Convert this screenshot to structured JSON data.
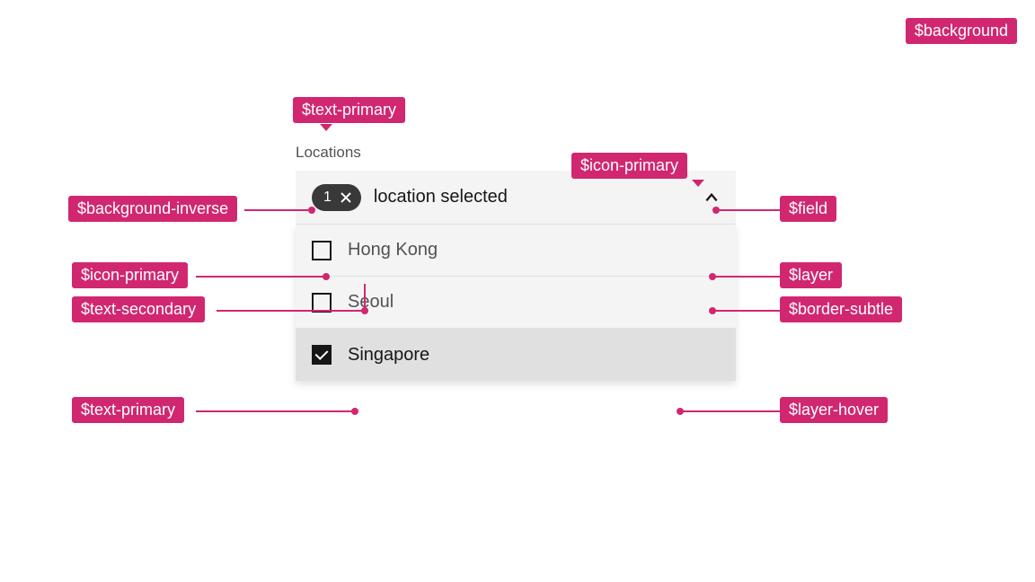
{
  "colors": {
    "annotation": "#d12771",
    "background": "#ffffff",
    "field": "#f4f4f4",
    "layer": "#f4f4f4",
    "layer_hover": "#e0e0e0",
    "border_subtle": "#e0e0e0",
    "text_primary": "#161616",
    "text_secondary": "#525252",
    "icon_primary": "#161616",
    "background_inverse": "#393939"
  },
  "annotations": {
    "top_right": "$background",
    "text_primary_label": "$text-primary",
    "background_inverse": "$background-inverse",
    "icon_primary_left": "$icon-primary",
    "text_secondary": "$text-secondary",
    "text_primary_bottom": "$text-primary",
    "icon_primary_right": "$icon-primary",
    "field": "$field",
    "layer": "$layer",
    "border_subtle": "$border-subtle",
    "layer_hover": "$layer-hover"
  },
  "multiselect": {
    "label": "Locations",
    "selected_count": "1",
    "placeholder": "location selected",
    "options": [
      {
        "label": "Hong Kong",
        "checked": false,
        "hover": false
      },
      {
        "label": "Seoul",
        "checked": false,
        "hover": false
      },
      {
        "label": "Singapore",
        "checked": true,
        "hover": true
      }
    ]
  }
}
